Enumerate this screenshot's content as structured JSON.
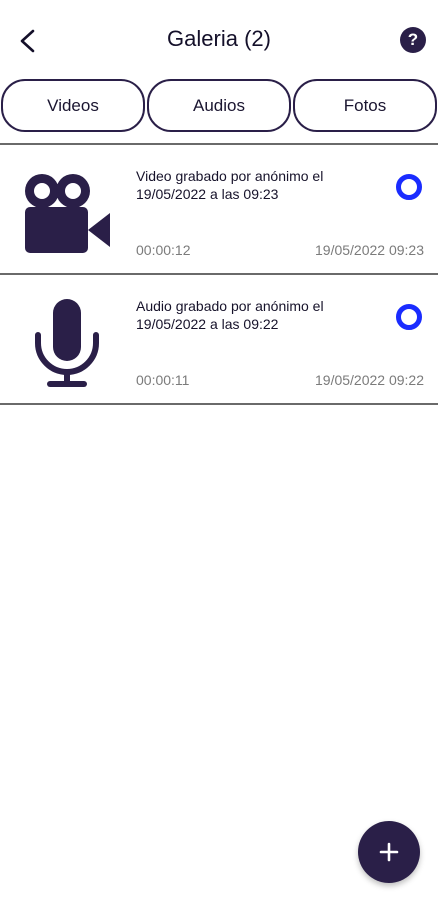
{
  "header": {
    "title": "Galeria (2)",
    "back_icon": "chevron-left-icon",
    "help_label": "?"
  },
  "tabs": [
    {
      "label": "Videos"
    },
    {
      "label": "Audios"
    },
    {
      "label": "Fotos"
    }
  ],
  "items": [
    {
      "type": "video",
      "icon": "video-camera-icon",
      "description": "Video grabado por anónimo el 19/05/2022  a las 09:23",
      "duration": "00:00:12",
      "datetime": "19/05/2022 09:23"
    },
    {
      "type": "audio",
      "icon": "microphone-icon",
      "description": "Audio grabado por anónimo el 19/05/2022  a las 09:22",
      "duration": "00:00:11",
      "datetime": "19/05/2022 09:22"
    }
  ],
  "fab": {
    "label": "+",
    "icon": "plus-icon"
  },
  "colors": {
    "primary": "#2a1f48",
    "radio": "#1a2cff",
    "muted_text": "#7b7b7b"
  }
}
